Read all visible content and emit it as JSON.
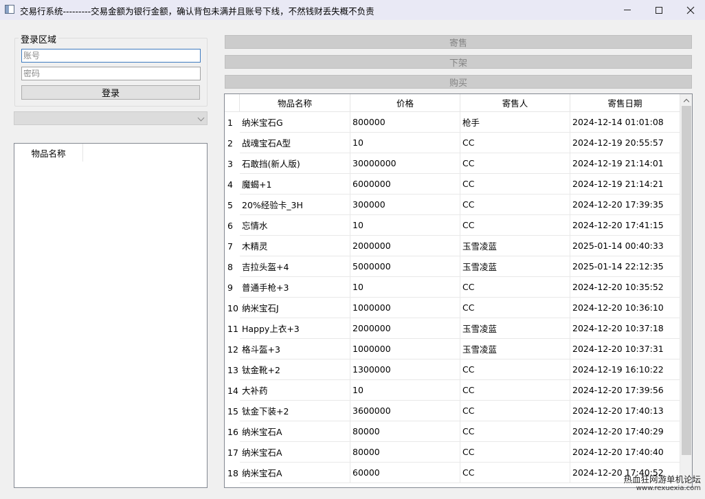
{
  "window": {
    "title": "交易行系统---------交易金额为银行金额，确认背包未满并且账号下线，不然钱财丢失概不负责"
  },
  "login": {
    "group_title": "登录区域",
    "account_placeholder": "账号",
    "password_placeholder": "密码",
    "login_label": "登录"
  },
  "left_list": {
    "header": "物品名称"
  },
  "actions": {
    "consign_label": "寄售",
    "delist_label": "下架",
    "buy_label": "购买"
  },
  "table": {
    "columns": [
      "物品名称",
      "价格",
      "寄售人",
      "寄售日期"
    ],
    "rows": [
      {
        "no": "1",
        "name": "纳米宝石G",
        "price": "800000",
        "seller": "枪手",
        "date": "2024-12-14 01:01:08"
      },
      {
        "no": "2",
        "name": "战魂宝石A型",
        "price": "10",
        "seller": "CC",
        "date": "2024-12-19 20:55:57"
      },
      {
        "no": "3",
        "name": "石敢挡(新人版)",
        "price": "30000000",
        "seller": "CC",
        "date": "2024-12-19 21:14:01"
      },
      {
        "no": "4",
        "name": "魔蝎+1",
        "price": "6000000",
        "seller": "CC",
        "date": "2024-12-19 21:14:21"
      },
      {
        "no": "5",
        "name": "20%经验卡_3H",
        "price": "300000",
        "seller": "CC",
        "date": "2024-12-20 17:39:35"
      },
      {
        "no": "6",
        "name": "忘情水",
        "price": "10",
        "seller": "CC",
        "date": "2024-12-20 17:41:15"
      },
      {
        "no": "7",
        "name": "木精灵",
        "price": "2000000",
        "seller": "玉雪凌蓝",
        "date": "2025-01-14 00:40:33"
      },
      {
        "no": "8",
        "name": "吉拉头盔+4",
        "price": "5000000",
        "seller": "玉雪凌蓝",
        "date": "2025-01-14 22:12:35"
      },
      {
        "no": "9",
        "name": "普通手枪+3",
        "price": "10",
        "seller": "CC",
        "date": "2024-12-20 10:35:52"
      },
      {
        "no": "10",
        "name": "纳米宝石J",
        "price": "1000000",
        "seller": "CC",
        "date": "2024-12-20 10:36:10"
      },
      {
        "no": "11",
        "name": "Happy上衣+3",
        "price": "2000000",
        "seller": "玉雪凌蓝",
        "date": "2024-12-20 10:37:18"
      },
      {
        "no": "12",
        "name": "格斗盔+3",
        "price": "1000000",
        "seller": "玉雪凌蓝",
        "date": "2024-12-20 10:37:31"
      },
      {
        "no": "13",
        "name": "钛金靴+2",
        "price": "1300000",
        "seller": "CC",
        "date": "2024-12-19 16:10:22"
      },
      {
        "no": "14",
        "name": "大补药",
        "price": "10",
        "seller": "CC",
        "date": "2024-12-20 17:39:56"
      },
      {
        "no": "15",
        "name": "钛金下装+2",
        "price": "3600000",
        "seller": "CC",
        "date": "2024-12-20 17:40:13"
      },
      {
        "no": "16",
        "name": "纳米宝石A",
        "price": "80000",
        "seller": "CC",
        "date": "2024-12-20 17:40:29"
      },
      {
        "no": "17",
        "name": "纳米宝石A",
        "price": "80000",
        "seller": "CC",
        "date": "2024-12-20 17:40:40"
      },
      {
        "no": "18",
        "name": "纳米宝石A",
        "price": "60000",
        "seller": "CC",
        "date": "2024-12-20 17:40:52"
      }
    ]
  },
  "watermark": {
    "line1": "热血狂网游单机论坛",
    "line2": "www.rexuexia.com"
  },
  "icons": {
    "minimize": "minimize-icon",
    "maximize": "maximize-icon",
    "close": "close-icon",
    "combo_arrow": "chevron-down-icon",
    "scroll_up": "chevron-up-icon"
  }
}
